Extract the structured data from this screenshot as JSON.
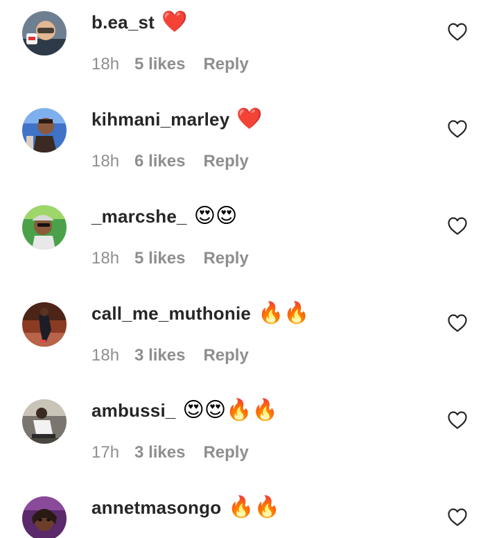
{
  "comments": [
    {
      "username": "b.ea_st",
      "text": "❤️",
      "time": "18h",
      "likes": "5 likes",
      "reply": "Reply",
      "avatar_icon": "user-avatar",
      "like_icon": "heart-outline-icon"
    },
    {
      "username": "kihmani_marley",
      "text": "❤️",
      "time": "18h",
      "likes": "6 likes",
      "reply": "Reply",
      "avatar_icon": "user-avatar",
      "like_icon": "heart-outline-icon"
    },
    {
      "username": "_marcshe_",
      "text": "😍😍",
      "time": "18h",
      "likes": "5 likes",
      "reply": "Reply",
      "avatar_icon": "user-avatar",
      "like_icon": "heart-outline-icon"
    },
    {
      "username": "call_me_muthonie",
      "text": "🔥🔥",
      "time": "18h",
      "likes": "3 likes",
      "reply": "Reply",
      "avatar_icon": "user-avatar",
      "like_icon": "heart-outline-icon"
    },
    {
      "username": "ambussi_",
      "text": "😍😍🔥🔥",
      "time": "17h",
      "likes": "3 likes",
      "reply": "Reply",
      "avatar_icon": "user-avatar",
      "like_icon": "heart-outline-icon"
    },
    {
      "username": "annetmasongo",
      "text": "🔥🔥",
      "avatar_icon": "user-avatar",
      "like_icon": "heart-outline-icon"
    }
  ],
  "colors": {
    "username": "#262626",
    "meta": "#8e8e8e",
    "heart_outline": "#262626"
  }
}
